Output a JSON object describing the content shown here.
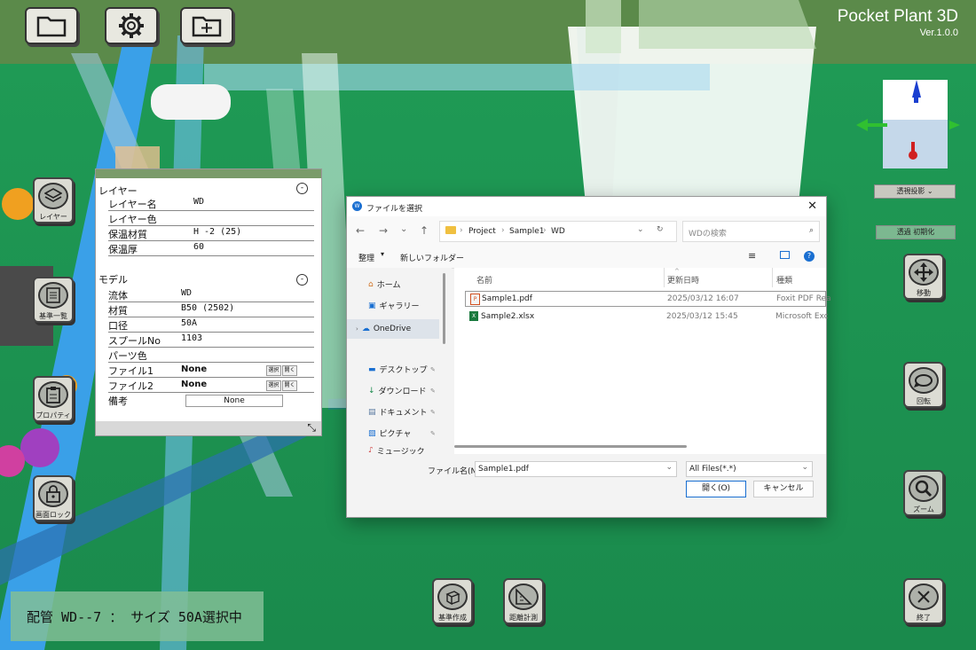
{
  "app": {
    "title": "Pocket Plant 3D",
    "version": "Ver.1.0.0"
  },
  "colors": {
    "floor": "#1f9a55",
    "sky": "#5b8a4a",
    "pipe_blue": "#3aa0e8",
    "accent": "#1a6fd1"
  },
  "toolbar_top": [
    {
      "name": "folder-button",
      "icon": "folder-icon"
    },
    {
      "name": "settings-button",
      "icon": "gear-icon"
    },
    {
      "name": "folder-add-button",
      "icon": "folder-add-icon"
    }
  ],
  "view": {
    "projection": "透視投影",
    "reset": "透過 初期化"
  },
  "left_tools": {
    "layer": "レイヤー",
    "base_list": "基準一覧",
    "property": "プロパティ",
    "lock": "画面ロック"
  },
  "right_tools": {
    "move": "移動",
    "rotate": "回転",
    "zoom": "ズーム",
    "exit": "終了"
  },
  "bottom_tools": {
    "create_base": "基準作成",
    "measure": "距離計測"
  },
  "status": "配管 WD--7 ： サイズ 50A選択中",
  "property_panel": {
    "layer_section": "レイヤー",
    "layer_rows": [
      {
        "key": "レイヤー名",
        "value": "WD"
      },
      {
        "key": "レイヤー色",
        "value": ""
      },
      {
        "key": "保温材質",
        "value": "H -2 (25)"
      },
      {
        "key": "保温厚",
        "value": "60"
      }
    ],
    "model_section": "モデル",
    "model_rows": [
      {
        "key": "流体",
        "value": "WD"
      },
      {
        "key": "材質",
        "value": "B50 (2502)"
      },
      {
        "key": "口径",
        "value": "50A"
      },
      {
        "key": "スプールNo",
        "value": "1103"
      },
      {
        "key": "パーツ色",
        "value": ""
      }
    ],
    "file1": {
      "key": "ファイル1",
      "value": "None"
    },
    "file2": {
      "key": "ファイル2",
      "value": "None"
    },
    "select_label": "選択",
    "open_label": "開く",
    "note": {
      "key": "備考",
      "value": "None"
    }
  },
  "dialog": {
    "title": "ファイルを選択",
    "breadcrumb": [
      "Project",
      "Sample1",
      "WD"
    ],
    "search_placeholder": "WDの検索",
    "organize": "整理",
    "new_folder": "新しいフォルダー",
    "nav": [
      "ホーム",
      "ギャラリー",
      "OneDrive",
      "デスクトップ",
      "ダウンロード",
      "ドキュメント",
      "ピクチャ",
      "ミュージック"
    ],
    "columns": [
      "名前",
      "更新日時",
      "種類"
    ],
    "files": [
      {
        "name": "Sample1.pdf",
        "date": "2025/03/12 16:07",
        "type": "Foxit PDF Rea"
      },
      {
        "name": "Sample2.xlsx",
        "date": "2025/03/12 15:45",
        "type": "Microsoft Exc"
      }
    ],
    "filename_label": "ファイル名(N):",
    "filename_value": "Sample1.pdf",
    "filter": "All Files(*.*)",
    "open_button": "開く(O)",
    "cancel_button": "キャンセル"
  }
}
